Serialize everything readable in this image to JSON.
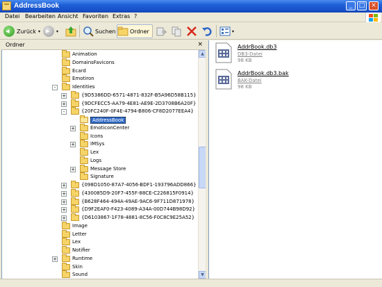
{
  "window": {
    "title": "AddressBook"
  },
  "menu": [
    "Datei",
    "Bearbeiten",
    "Ansicht",
    "Favoriten",
    "Extras",
    "?"
  ],
  "toolbar": {
    "back": "Zurück",
    "search": "Suchen",
    "folders": "Ordner"
  },
  "folder_pane": {
    "title": "Ordner",
    "close": "×"
  },
  "tree": [
    {
      "label": "Animation",
      "indent": 0,
      "exp": ""
    },
    {
      "label": "DomainsFavicons",
      "indent": 0,
      "exp": ""
    },
    {
      "label": "Ecard",
      "indent": 0,
      "exp": ""
    },
    {
      "label": "Emotiron",
      "indent": 0,
      "exp": ""
    },
    {
      "label": "Identities",
      "indent": 0,
      "exp": "-"
    },
    {
      "label": "{9D5386DD-6571-4871-832F-B5A96D58B115}",
      "indent": 1,
      "exp": "+"
    },
    {
      "label": "{9DCFECC5-AA79-4E81-AE9E-2D3708B6A20F}",
      "indent": 1,
      "exp": "+"
    },
    {
      "label": "{20FC240F-0F4E-4794-B806-CF8D2077EEA4}",
      "indent": 1,
      "exp": "-"
    },
    {
      "label": "AddressBook",
      "indent": 2,
      "exp": "",
      "selected": true
    },
    {
      "label": "EmoticonCenter",
      "indent": 2,
      "exp": "+"
    },
    {
      "label": "Icons",
      "indent": 2,
      "exp": ""
    },
    {
      "label": "IMSys",
      "indent": 2,
      "exp": "+"
    },
    {
      "label": "Lex",
      "indent": 2,
      "exp": ""
    },
    {
      "label": "Logs",
      "indent": 2,
      "exp": ""
    },
    {
      "label": "Message Store",
      "indent": 2,
      "exp": "+"
    },
    {
      "label": "Signature",
      "indent": 2,
      "exp": ""
    },
    {
      "label": "{098D1050-87A7-4056-BDF1-193796ADD866}",
      "indent": 1,
      "exp": "+"
    },
    {
      "label": "{430085D9-20F7-455F-88CE-C226815F0914}",
      "indent": 1,
      "exp": "+"
    },
    {
      "label": "{B628F464-494A-49AE-9AC6-9F711D871978}",
      "indent": 1,
      "exp": "+"
    },
    {
      "label": "{D9F2EAF0-F423-4089-A34A-00D744B98D92}",
      "indent": 1,
      "exp": "+"
    },
    {
      "label": "{D6103867-1F78-4881-8C56-F0C8C9E25A52}",
      "indent": 1,
      "exp": "+"
    },
    {
      "label": "Image",
      "indent": 0,
      "exp": ""
    },
    {
      "label": "Letter",
      "indent": 0,
      "exp": ""
    },
    {
      "label": "Lex",
      "indent": 0,
      "exp": ""
    },
    {
      "label": "Notifier",
      "indent": 0,
      "exp": ""
    },
    {
      "label": "Runtime",
      "indent": 0,
      "exp": "+"
    },
    {
      "label": "Skin",
      "indent": 0,
      "exp": ""
    },
    {
      "label": "Sound",
      "indent": 0,
      "exp": ""
    }
  ],
  "files": [
    {
      "name": "AddrBook.db3",
      "type": "DB3-Datei",
      "size": "98 KB"
    },
    {
      "name": "AddrBook.db3.bak",
      "type": "BAK-Datei",
      "size": "98 KB"
    }
  ],
  "colors": {
    "titlebar": "#1e5fd6",
    "selection": "#316ac5",
    "folder": "#f6d467"
  }
}
